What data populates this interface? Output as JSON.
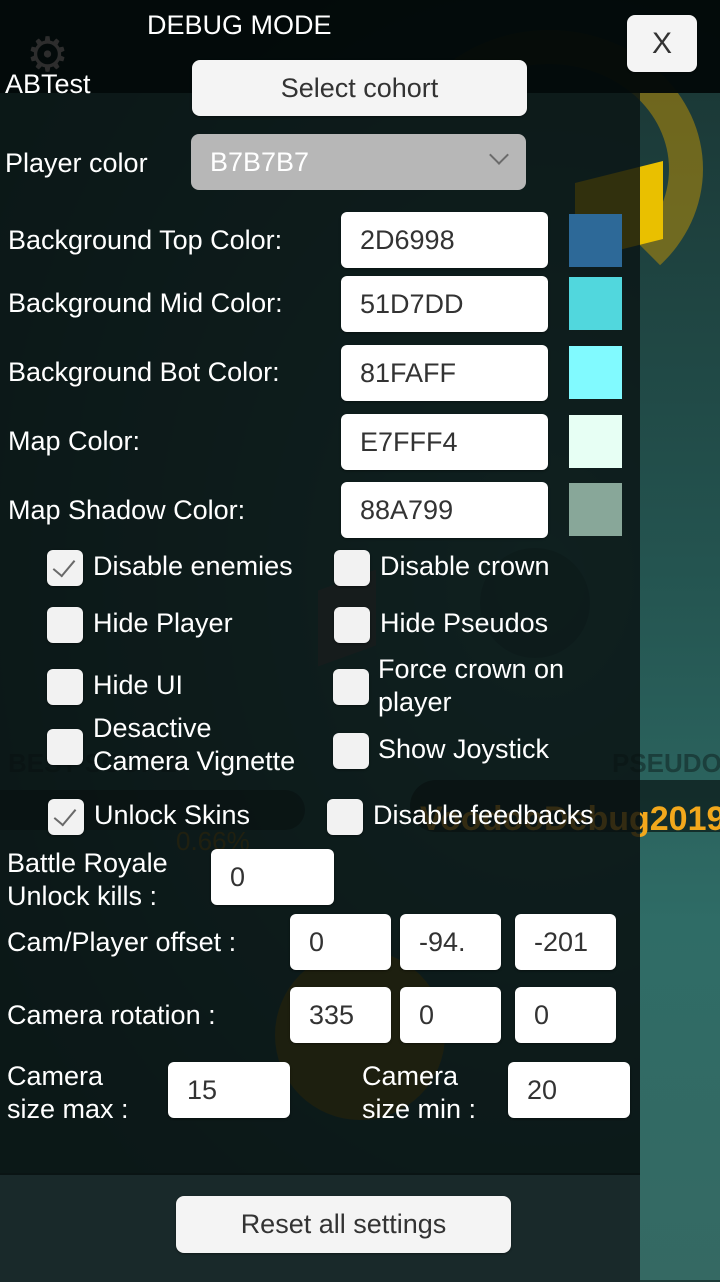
{
  "header": {
    "title": "DEBUG MODE",
    "close_label": "X"
  },
  "abtest": {
    "label": "ABTest",
    "button_label": "Select cohort"
  },
  "player_color": {
    "label": "Player color",
    "value": "B7B7B7"
  },
  "colors": [
    {
      "label": "Background Top Color:",
      "value": "2D6998",
      "swatch": "#2D6998"
    },
    {
      "label": "Background Mid Color:",
      "value": "51D7DD",
      "swatch": "#51D7DD"
    },
    {
      "label": "Background Bot Color:",
      "value": "81FAFF",
      "swatch": "#81FAFF"
    },
    {
      "label": "Map Color:",
      "value": "E7FFF4",
      "swatch": "#E7FFF4"
    },
    {
      "label": "Map Shadow Color:",
      "value": "88A799",
      "swatch": "#88A799"
    }
  ],
  "checkboxes": [
    {
      "label": "Disable enemies",
      "checked": true
    },
    {
      "label": "Disable crown",
      "checked": false
    },
    {
      "label": "Hide Player",
      "checked": false
    },
    {
      "label": "Hide Pseudos",
      "checked": false
    },
    {
      "label": "Hide UI",
      "checked": false
    },
    {
      "label_line1": "Force crown on",
      "label_line2": "player",
      "checked": false
    },
    {
      "label_line1": "Desactive",
      "label_line2": "Camera Vignette",
      "checked": false
    },
    {
      "label": "Show Joystick",
      "checked": false
    },
    {
      "label": "Unlock Skins",
      "checked": true
    },
    {
      "label": "Disable feedbacks",
      "checked": false
    }
  ],
  "battle_royale": {
    "label_line1": "Battle Royale",
    "label_line2": "Unlock kills :",
    "value": "0"
  },
  "cam_offset": {
    "label": "Cam/Player offset :",
    "x": "0",
    "y": "-94.",
    "z": "-201"
  },
  "cam_rotation": {
    "label": "Camera rotation :",
    "x": "335",
    "y": "0",
    "z": "0"
  },
  "cam_size_max": {
    "label_line1": "Camera",
    "label_line2": "size max :",
    "value": "15"
  },
  "cam_size_min": {
    "label_line1": "Camera",
    "label_line2": "size min :",
    "value": "20"
  },
  "footer": {
    "reset_label": "Reset all settings"
  },
  "background_game": {
    "pseudo_header": "PSEUDO",
    "best_header": "BEST SCORE",
    "pseudo_name": "VoodooDebug2019",
    "best_percent": "0.66%"
  }
}
